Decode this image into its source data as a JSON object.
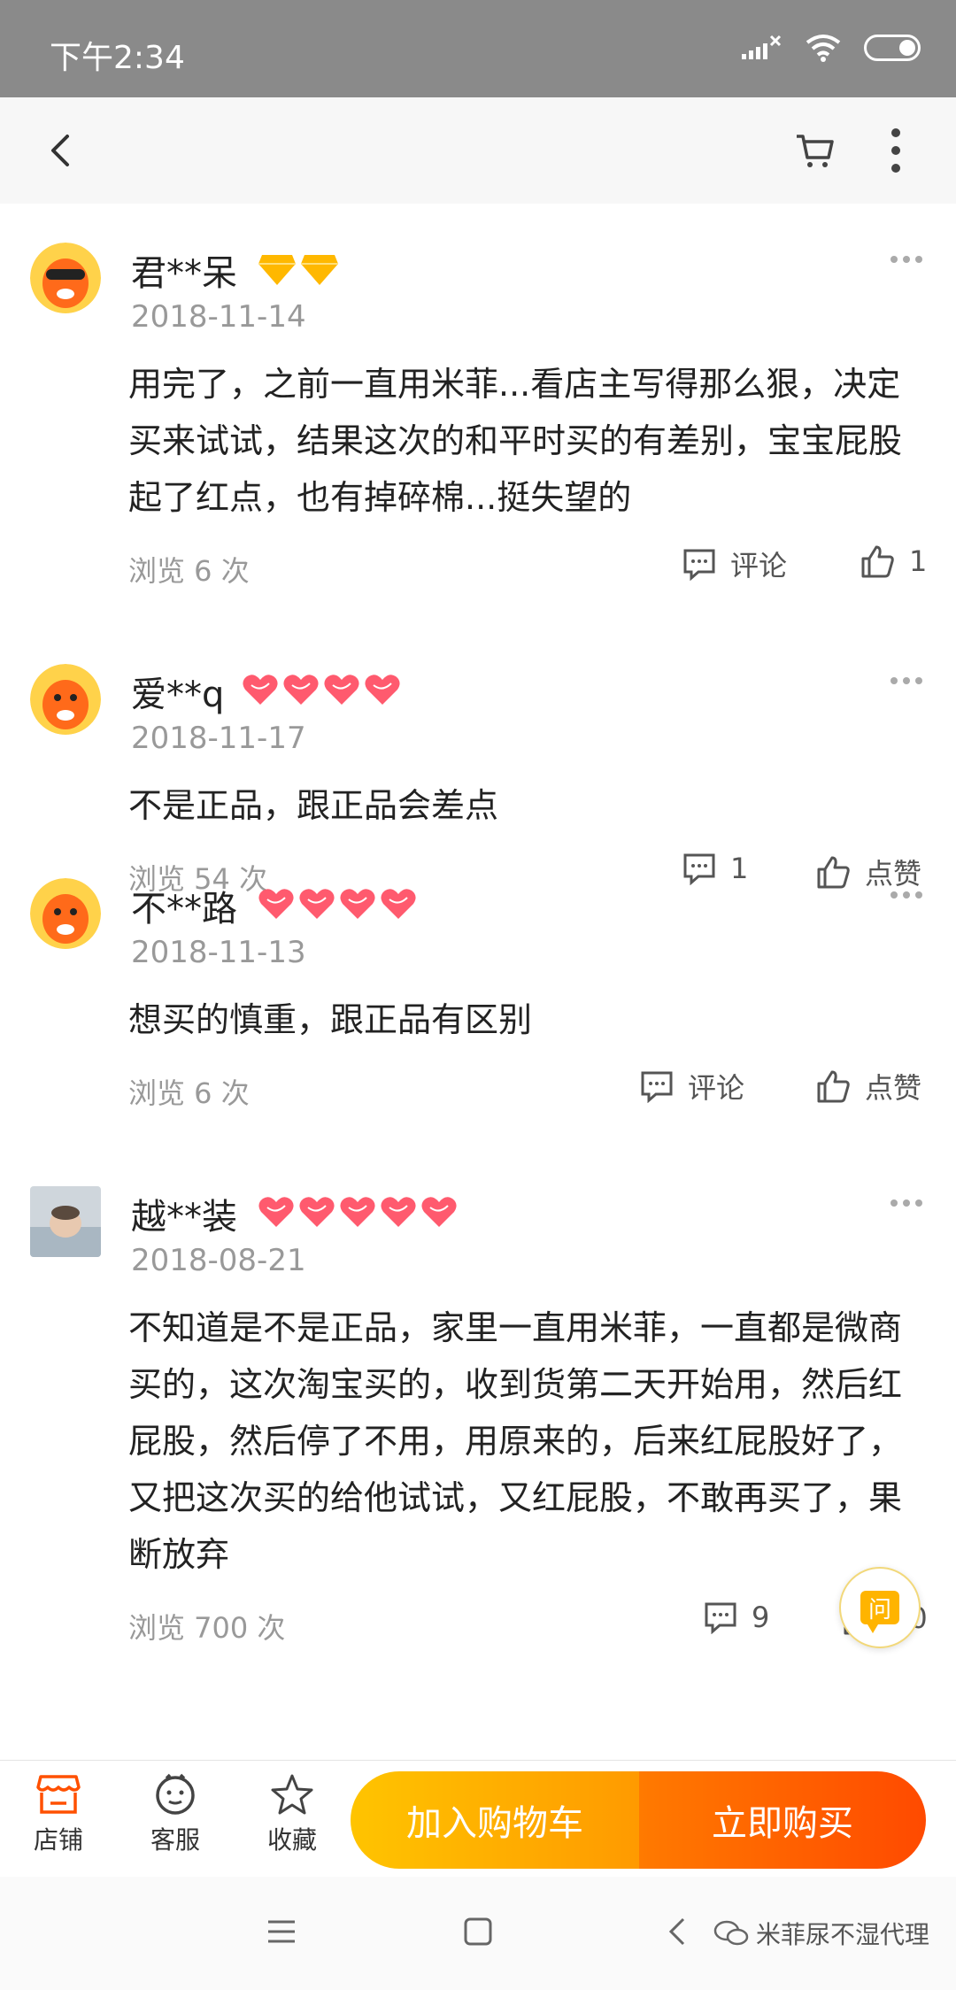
{
  "status_bar": {
    "time": "下午2:34"
  },
  "reviews": [
    {
      "user": "君**呆",
      "badge_type": "diamond",
      "badge_count": 2,
      "date": "2018-11-14",
      "content": "用完了，之前一直用米菲...看店主写得那么狠，决定买来试试，结果这次的和平时买的有差别，宝宝屁股起了红点，也有掉碎棉...挺失望的",
      "views": "浏览 6 次",
      "comment": "评论",
      "like": "1"
    },
    {
      "user": "爱**q",
      "badge_type": "heart",
      "badge_count": 4,
      "date": "2018-11-17",
      "content": "不是正品，跟正品会差点",
      "views": "浏览 54 次",
      "comment": "1",
      "like": "点赞"
    },
    {
      "user": "不**路",
      "badge_type": "heart",
      "badge_count": 4,
      "date": "2018-11-13",
      "content": "想买的慎重，跟正品有区别",
      "views": "浏览 6 次",
      "comment": "评论",
      "like": "点赞"
    },
    {
      "user": "越**装",
      "badge_type": "heart",
      "badge_count": 5,
      "date": "2018-08-21",
      "content": "不知道是不是正品，家里一直用米菲，一直都是微商买的，这次淘宝买的，收到货第二天开始用，然后红屁股，然后停了不用，用原来的，后来红屁股好了，又把这次买的给他试试，又红屁股，不敢再买了，果断放弃",
      "views": "浏览 700 次",
      "comment": "9",
      "like": "10"
    }
  ],
  "ask_button": "问",
  "bottom_bar": {
    "tabs": [
      {
        "label": "店铺",
        "icon": "store-icon"
      },
      {
        "label": "客服",
        "icon": "customer-service-icon"
      },
      {
        "label": "收藏",
        "icon": "star-icon"
      }
    ],
    "add_to_cart": "加入购物车",
    "buy_now": "立即购买"
  },
  "watermark": "米菲尿不湿代理",
  "colors": {
    "accent_orange": "#ff5000",
    "yellow": "#ffc400",
    "text_gray": "#999999"
  }
}
